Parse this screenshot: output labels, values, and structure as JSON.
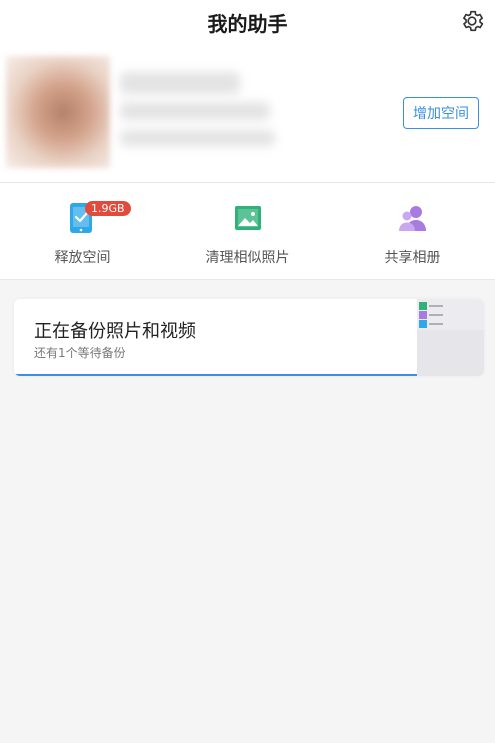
{
  "header": {
    "title": "我的助手",
    "settings_icon": "gear-icon"
  },
  "profile": {
    "add_space_label": "增加空间"
  },
  "actions": [
    {
      "label": "释放空间",
      "icon": "phone-clean-icon",
      "badge": "1.9GB",
      "color": "#2fa8e8"
    },
    {
      "label": "清理相似照片",
      "icon": "image-icon",
      "color": "#2fb27a"
    },
    {
      "label": "共享相册",
      "icon": "people-icon",
      "color": "#a77be0"
    }
  ],
  "backup": {
    "title": "正在备份照片和视频",
    "subtitle": "还有1个等待备份",
    "progress": 0.86
  },
  "colors": {
    "accent": "#3a8ee6",
    "badge": "#e24b3b",
    "background": "#f5f5f5"
  }
}
